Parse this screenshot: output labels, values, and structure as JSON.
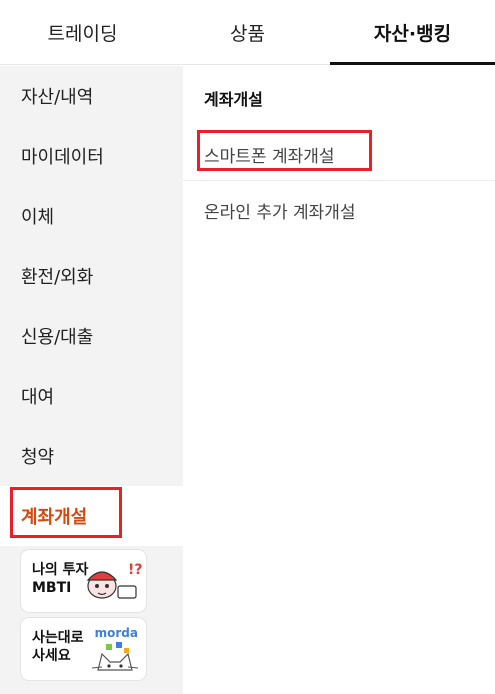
{
  "tabs": [
    {
      "label": "트레이딩"
    },
    {
      "label": "상품"
    },
    {
      "label": "자산·뱅킹"
    }
  ],
  "sidebar": {
    "items": [
      {
        "label": "자산/내역"
      },
      {
        "label": "마이데이터"
      },
      {
        "label": "이체"
      },
      {
        "label": "환전/외화"
      },
      {
        "label": "신용/대출"
      },
      {
        "label": "대여"
      },
      {
        "label": "청약"
      },
      {
        "label": "계좌개설"
      }
    ]
  },
  "promos": [
    {
      "line1": "나의 투자",
      "line2": "MBTI",
      "icon": "character-illustration-icon"
    },
    {
      "line1": "사는대로",
      "line2": "사세요",
      "brand": "morda",
      "icon": "morda-cat-icon"
    }
  ],
  "main": {
    "section_title": "계좌개설",
    "links": [
      {
        "label": "스마트폰 계좌개설"
      },
      {
        "label": "온라인 추가 계좌개설"
      }
    ]
  },
  "colors": {
    "active_sidebar_text": "#d9480f",
    "highlight_box": "#e8202a",
    "sidebar_bg": "#f3f3f3"
  }
}
